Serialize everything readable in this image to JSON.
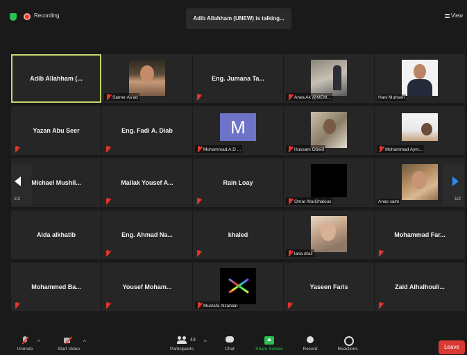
{
  "top_bar": {
    "recording_label": "Recording",
    "talking_label": "Adib Allahham (UNEW) is talking...",
    "view_label": "View"
  },
  "pager": {
    "left_page": "1/2",
    "right_page": "1/2"
  },
  "tiles": [
    {
      "name": "Adib Allahham (...",
      "type": "name",
      "active": true
    },
    {
      "name": "Samer As'ad",
      "type": "video"
    },
    {
      "name": "Eng. Jumana Ta...",
      "type": "name"
    },
    {
      "name": "Arwa Ak @MEM...",
      "type": "video"
    },
    {
      "name": "Hani Muhsen",
      "type": "video"
    },
    {
      "name": "Yazan Abu Seer",
      "type": "name"
    },
    {
      "name": "Eng. Fadi A. Diab",
      "type": "name"
    },
    {
      "name": "Mohammad.A.D ...",
      "type": "avatar",
      "initial": "M"
    },
    {
      "name": "Hussam Obeid",
      "type": "video"
    },
    {
      "name": "Mohammad Aym...",
      "type": "video"
    },
    {
      "name": "Michael  Mushil...",
      "type": "name"
    },
    {
      "name": "Mallak Yousef A...",
      "type": "name"
    },
    {
      "name": "Rain Loay",
      "type": "name"
    },
    {
      "name": "Omar AbuGhalous",
      "type": "video"
    },
    {
      "name": "Anas salm",
      "type": "video"
    },
    {
      "name": "Aida alkhatib",
      "type": "name"
    },
    {
      "name": "Eng. Ahmad Na...",
      "type": "name"
    },
    {
      "name": "khaled",
      "type": "name"
    },
    {
      "name": "lana draz",
      "type": "video"
    },
    {
      "name": "Mohammad Far...",
      "type": "name"
    },
    {
      "name": "Mohammed Ba...",
      "type": "name"
    },
    {
      "name": "Yousef Moham...",
      "type": "name"
    },
    {
      "name": "Mustafa Alzahlan",
      "type": "video"
    },
    {
      "name": "Yaseen Faris",
      "type": "name"
    },
    {
      "name": "Zaid Alhalhouli...",
      "type": "name"
    }
  ],
  "toolbar": {
    "unmute": "Unmute",
    "start_video": "Start Video",
    "participants": "Participants",
    "participants_count": "43",
    "chat": "Chat",
    "share_screen": "Share Screen",
    "record": "Record",
    "reactions": "Reactions",
    "leave": "Leave"
  },
  "colors": {
    "active_speaker_border": "#c6d86c",
    "share_green": "#2dbf4f",
    "leave_red": "#d83a33",
    "muted_red": "#e5352d"
  }
}
